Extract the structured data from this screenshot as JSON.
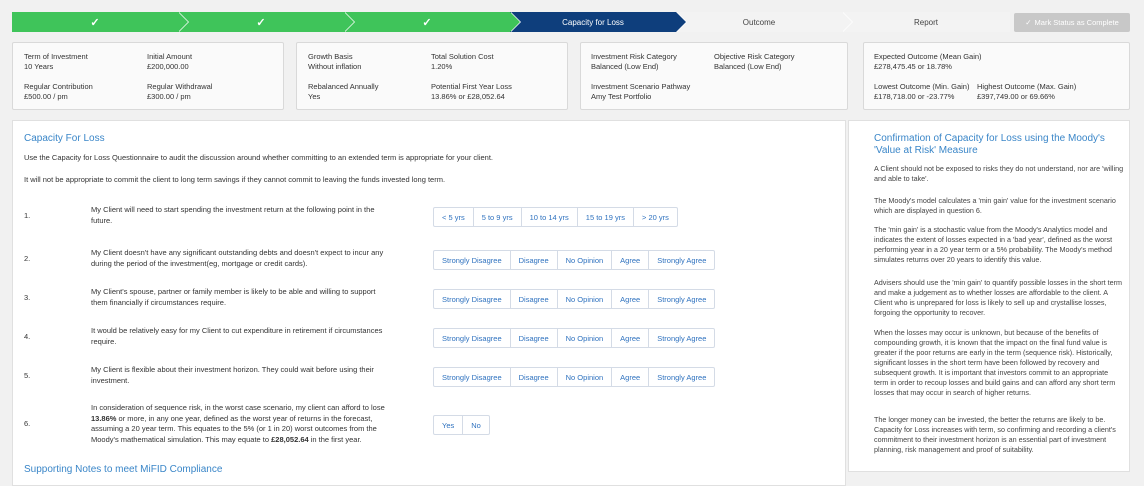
{
  "progress": {
    "steps": [
      {
        "label": "",
        "state": "done"
      },
      {
        "label": "",
        "state": "done"
      },
      {
        "label": "",
        "state": "done"
      },
      {
        "label": "Capacity for Loss",
        "state": "active"
      },
      {
        "label": "Outcome",
        "state": "todo"
      },
      {
        "label": "Report",
        "state": "todo"
      }
    ],
    "check_glyph": "✓",
    "mark_button": "Mark Status as Complete",
    "mark_icon": "✓"
  },
  "summary": {
    "term_label": "Term of Investment",
    "term_value": "10 Years",
    "initial_label": "Initial Amount",
    "initial_value": "£200,000.00",
    "regular_contrib_label": "Regular Contribution",
    "regular_contrib_value": "£500.00 / pm",
    "regular_withdraw_label": "Regular Withdrawal",
    "regular_withdraw_value": "£300.00 / pm",
    "growth_label": "Growth Basis",
    "growth_value": "Without inflation",
    "cost_label": "Total Solution Cost",
    "cost_value": "1.20%",
    "rebalance_label": "Rebalanced Annually",
    "rebalance_value": "Yes",
    "first_loss_label": "Potential First Year Loss",
    "first_loss_value": "13.86% or £28,052.64",
    "risk_cat_label": "Investment Risk Category",
    "risk_cat_value": "Balanced (Low End)",
    "obj_risk_label": "Objective Risk Category",
    "obj_risk_value": "Balanced (Low End)",
    "pathway_label": "Investment Scenario Pathway",
    "pathway_value": "Amy Test Portfolio",
    "expected_label": "Expected Outcome (Mean Gain)",
    "expected_value": "£278,475.45 or 18.78%",
    "lowest_label": "Lowest Outcome (Min. Gain)",
    "lowest_value": "£178,718.00 or -23.77%",
    "highest_label": "Highest Outcome (Max. Gain)",
    "highest_value": "£397,749.00 or 69.66%"
  },
  "main": {
    "title": "Capacity For Loss",
    "intro1": "Use the Capacity for Loss Questionnaire to audit the discussion around whether committing to an extended term is appropriate for your client.",
    "intro2": "It will not be appropriate to commit the client to long term savings if they cannot commit to leaving the funds invested long term.",
    "questions": [
      {
        "num": "1.",
        "text": "My Client will need to start spending the investment return at the following point in the future."
      },
      {
        "num": "2.",
        "text": "My Client doesn't have any significant outstanding debts and doesn't expect to incur any during the period of the investment(eg, mortgage or credit cards)."
      },
      {
        "num": "3.",
        "text": "My Client's spouse, partner or family member is likely to be able and willing to support them financially if circumstances require."
      },
      {
        "num": "4.",
        "text": "It would be relatively easy for my Client to cut expenditure in retirement if circumstances require."
      },
      {
        "num": "5.",
        "text": "My Client is flexible about their investment horizon. They could wait before using their investment."
      },
      {
        "num": "6.",
        "text_a": "In consideration of sequence risk, in the worst case scenario, my client can afford to lose ",
        "text_b": "13.86%",
        "text_c": " or more, in any one year, defined as the worst year of returns in the forecast, assuming a 20 year term. This equates to the 5% (or 1 in 20) worst outcomes from the Moody's mathematical simulation. This may equate to ",
        "text_d": "£28,052.64",
        "text_e": " in the first year."
      }
    ],
    "term_options": [
      "< 5 yrs",
      "5 to 9 yrs",
      "10 to 14 yrs",
      "15 to 19 yrs",
      "> 20 yrs"
    ],
    "agree_options": [
      "Strongly Disagree",
      "Disagree",
      "No Opinion",
      "Agree",
      "Strongly Agree"
    ],
    "yn_options": [
      "Yes",
      "No"
    ],
    "support_title": "Supporting Notes to meet MiFID Compliance"
  },
  "side": {
    "title": "Confirmation of Capacity for Loss using the Moody's 'Value at Risk' Measure",
    "p1": "A Client should not be exposed to risks they do not understand, nor are 'willing and able to take'.",
    "p2": "The Moody's model calculates a 'min gain' value for the investment scenario which are displayed in question 6.",
    "p3": "The 'min gain' is a stochastic value from the Moody's Analytics model and indicates the extent of losses expected in a 'bad year', defined as the worst performing year in a 20 year term or a 5% probability. The Moody's method simulates returns over 20 years to identify this value.",
    "p4": "Advisers should use the 'min gain' to quantify possible losses in the short term and make a judgement as to whether losses are affordable to the client. A Client who is unprepared for loss is likely to sell up and crystallise losses, forgoing the opportunity to recover.",
    "p5": "When the losses may occur is unknown, but because of the benefits of compounding growth, it is known that the impact on the final fund value is greater if the poor returns are early in the term (sequence risk). Historically, significant losses in the short term have been followed by recovery and subsequent growth. It is important that investors commit to an appropriate term in order to recoup losses and build gains and can afford any short term losses that may occur in search of higher returns.",
    "p6": "The longer money can be invested, the better the returns are likely to be. Capacity for Loss increases with term, so confirming and recording a client's commitment to their investment horizon is an essential part of investment planning, risk management and proof of suitability."
  }
}
